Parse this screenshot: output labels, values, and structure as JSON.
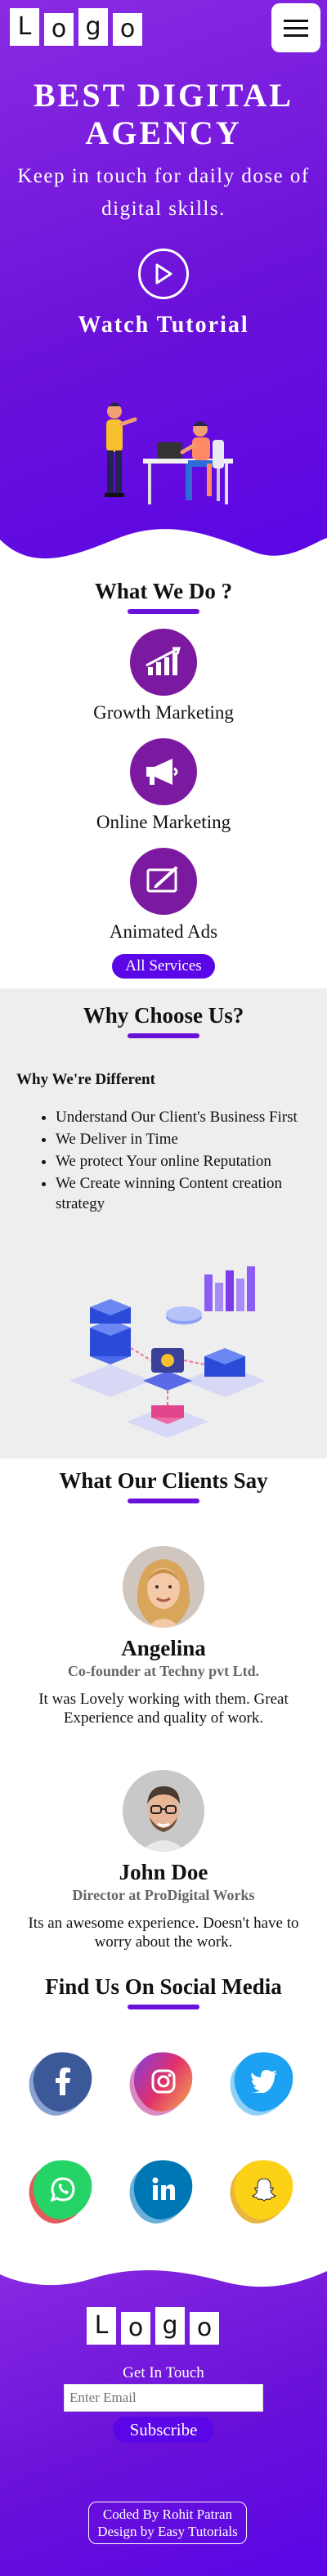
{
  "header": {
    "logo_letters": [
      "L",
      "o",
      "g",
      "o"
    ],
    "menu_icon": "hamburger-icon"
  },
  "hero": {
    "title": "BEST DIGITAL AGENCY",
    "tagline": "Keep in touch for daily dose of digital skills.",
    "play_icon": "play-circle-icon",
    "watch_label": "Watch Tutorial"
  },
  "services": {
    "title": "What We Do ?",
    "items": [
      {
        "label": "Growth Marketing",
        "icon": "growth-chart-icon"
      },
      {
        "label": "Online Marketing",
        "icon": "megaphone-icon"
      },
      {
        "label": "Animated Ads",
        "icon": "pen-tablet-icon"
      }
    ],
    "button_label": "All Services"
  },
  "why": {
    "title": "Why Choose Us?",
    "subtitle": "Why We're Different",
    "points": [
      "Understand Our Client's Business First",
      "We Deliver in Time",
      "We protect Your online Reputation",
      "We Create winning Content creation strategy"
    ]
  },
  "clients": {
    "title": "What Our Clients Say",
    "items": [
      {
        "name": "Angelina",
        "role": "Co-founder at Techny pvt Ltd.",
        "quote": "It was Lovely working with them. Great Experience and quality of work."
      },
      {
        "name": "John Doe",
        "role": "Director at ProDigital Works",
        "quote": "Its an awesome experience. Doesn't have to worry about the work."
      }
    ]
  },
  "social": {
    "title": "Find Us On Social Media",
    "items": [
      {
        "name": "facebook-icon",
        "color": "#3b5998"
      },
      {
        "name": "instagram-icon",
        "color": "#c13584"
      },
      {
        "name": "twitter-icon",
        "color": "#1da1f2"
      },
      {
        "name": "whatsapp-icon",
        "color": "#25d366"
      },
      {
        "name": "linkedin-icon",
        "color": "#0077b5"
      },
      {
        "name": "snapchat-icon",
        "color": "#fffc00"
      }
    ]
  },
  "footer": {
    "logo_letters": [
      "L",
      "o",
      "g",
      "o"
    ],
    "get_in_touch": "Get In Touch",
    "email_placeholder": "Enter Email",
    "subscribe_label": "Subscribe",
    "credit_line1": "Coded By Rohit Patran",
    "credit_line2": "Design by Easy Tutorials"
  },
  "colors": {
    "primary": "#6a11d9",
    "accent": "#5a06e6",
    "service_circle": "#7b1aa0"
  }
}
